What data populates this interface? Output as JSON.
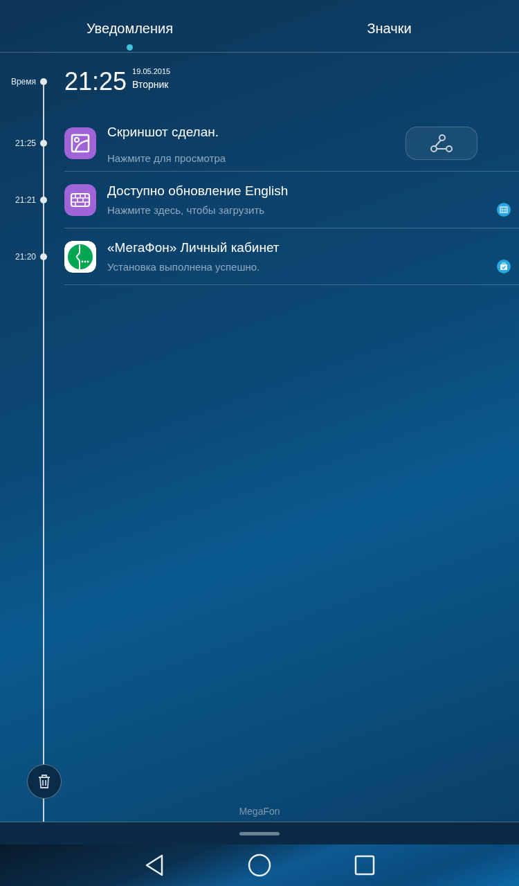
{
  "tabs": [
    {
      "label": "Уведомления",
      "selected": true
    },
    {
      "label": "Значки",
      "selected": false
    }
  ],
  "timeline": {
    "label": "Время",
    "time": "21:25",
    "date": "19.05.2015",
    "weekday": "Вторник"
  },
  "notifications": [
    {
      "time": "21:25",
      "kind": "screenshot",
      "title": "Скриншот сделан.",
      "text": "Нажмите для просмотра",
      "action": {
        "kind": "share"
      }
    },
    {
      "time": "21:21",
      "kind": "keyboard",
      "title": "Доступно обновление English",
      "text": "Нажмите здесь, чтобы загрузить",
      "action": {
        "kind": "keyboard-badge"
      }
    },
    {
      "time": "21:20",
      "kind": "megafon",
      "title": "«МегаФон» Личный кабинет",
      "text": "Установка выполнена успешно.",
      "action": {
        "kind": "install-badge"
      }
    }
  ],
  "carrier": "MegaFon"
}
